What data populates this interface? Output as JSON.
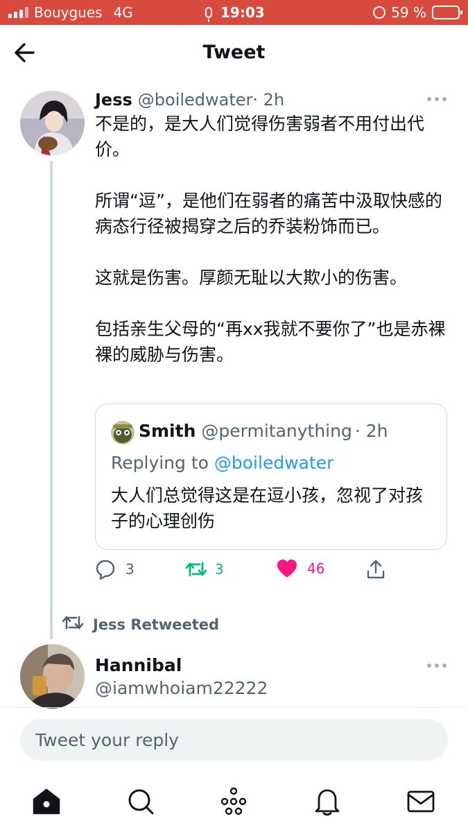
{
  "status_bar": {
    "carrier": "Bouygues",
    "network": "4G",
    "time": "19:03",
    "battery": "59 %"
  },
  "header": {
    "title": "Tweet",
    "back_icon": "back-arrow-icon"
  },
  "tweet": {
    "name": "Jess",
    "handle": "@boiledwater",
    "time": "· 2h",
    "paragraphs": [
      "不是的，是大人们觉得伤害弱者不用付出代价。",
      "所谓“逗”，是他们在弱者的痛苦中汲取快感的病态行径被揭穿之后的乔装粉饰而已。",
      "这就是伤害。厚颜无耻以大欺小的伤害。",
      "包括亲生父母的“再xx我就不要你了”也是赤裸裸的威胁与伤害。"
    ],
    "quote": {
      "name": "Smith",
      "handle": "@permitanything",
      "time": "· 2h",
      "replying_prefix": "Replying to ",
      "replying_to": "@boiledwater",
      "text": "大人们总觉得这是在逗小孩，忽视了对孩子的心理创伤"
    },
    "actions": {
      "replies": "3",
      "retweets": "3",
      "likes": "46"
    },
    "colors": {
      "retweet": "#00ba7c",
      "like": "#f91880",
      "link": "#1d9bf0"
    }
  },
  "retweet_label": "Jess Retweeted",
  "next_tweet": {
    "name": "Hannibal",
    "handle": "@iamwhoiam22222"
  },
  "reply_box": {
    "placeholder": "Tweet your reply"
  },
  "tabbar": {
    "items": [
      "home-icon",
      "search-icon",
      "spaces-icon",
      "notifications-icon",
      "messages-icon"
    ]
  }
}
